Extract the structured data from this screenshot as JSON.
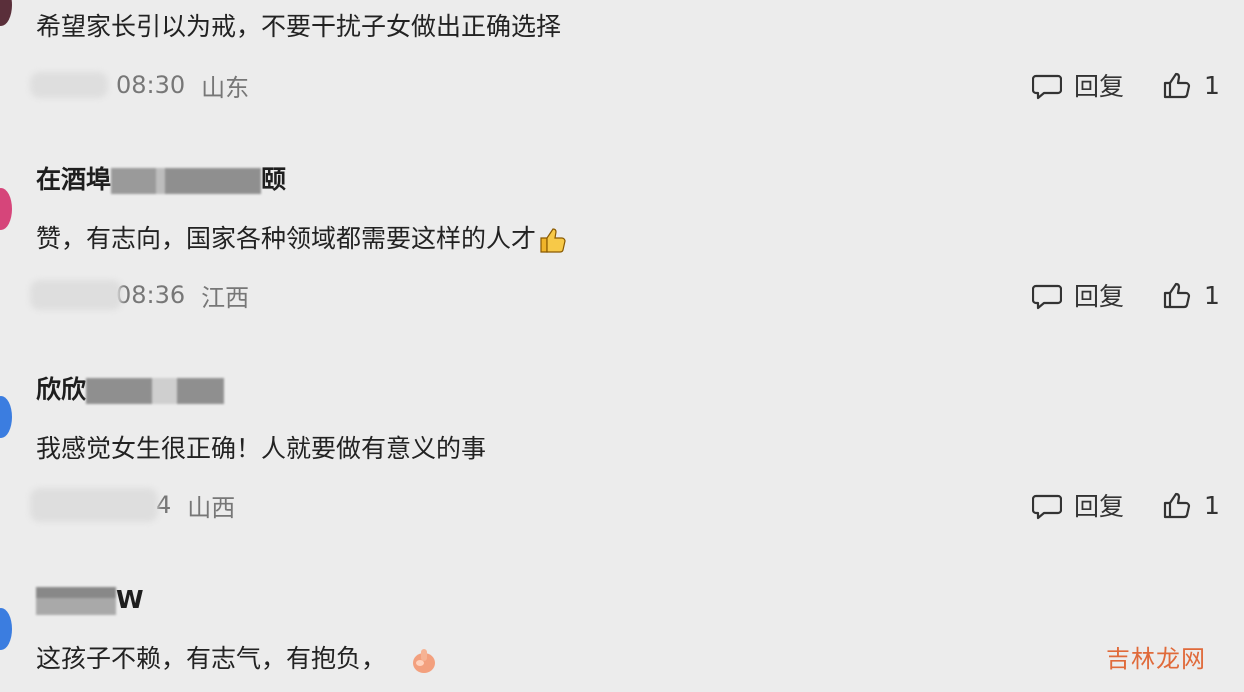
{
  "comments": [
    {
      "name": "",
      "text": "希望家长引以为戒，不要干扰子女做出正确选择",
      "time": "08:30",
      "location": "山东",
      "reply_label": "回复",
      "like_count": "1"
    },
    {
      "name_prefix": "在酒埠",
      "name_suffix": "颐",
      "text": "赞，有志向，国家各种领域都需要这样的人才",
      "time": "08:36",
      "location": "江西",
      "reply_label": "回复",
      "like_count": "1"
    },
    {
      "name_prefix": "欣欣",
      "text": "我感觉女生很正确！人就要做有意义的事",
      "time": "4",
      "location": "山西",
      "reply_label": "回复",
      "like_count": "1"
    },
    {
      "name_suffix": "W",
      "text": "这孩子不赖，有志气，有抱负，"
    }
  ],
  "watermark": "吉林龙网",
  "colors": {
    "background": "#ececec",
    "avatar_pink": "#d6457a",
    "avatar_blue": "#3b7de0",
    "meta_gray": "#777777"
  }
}
